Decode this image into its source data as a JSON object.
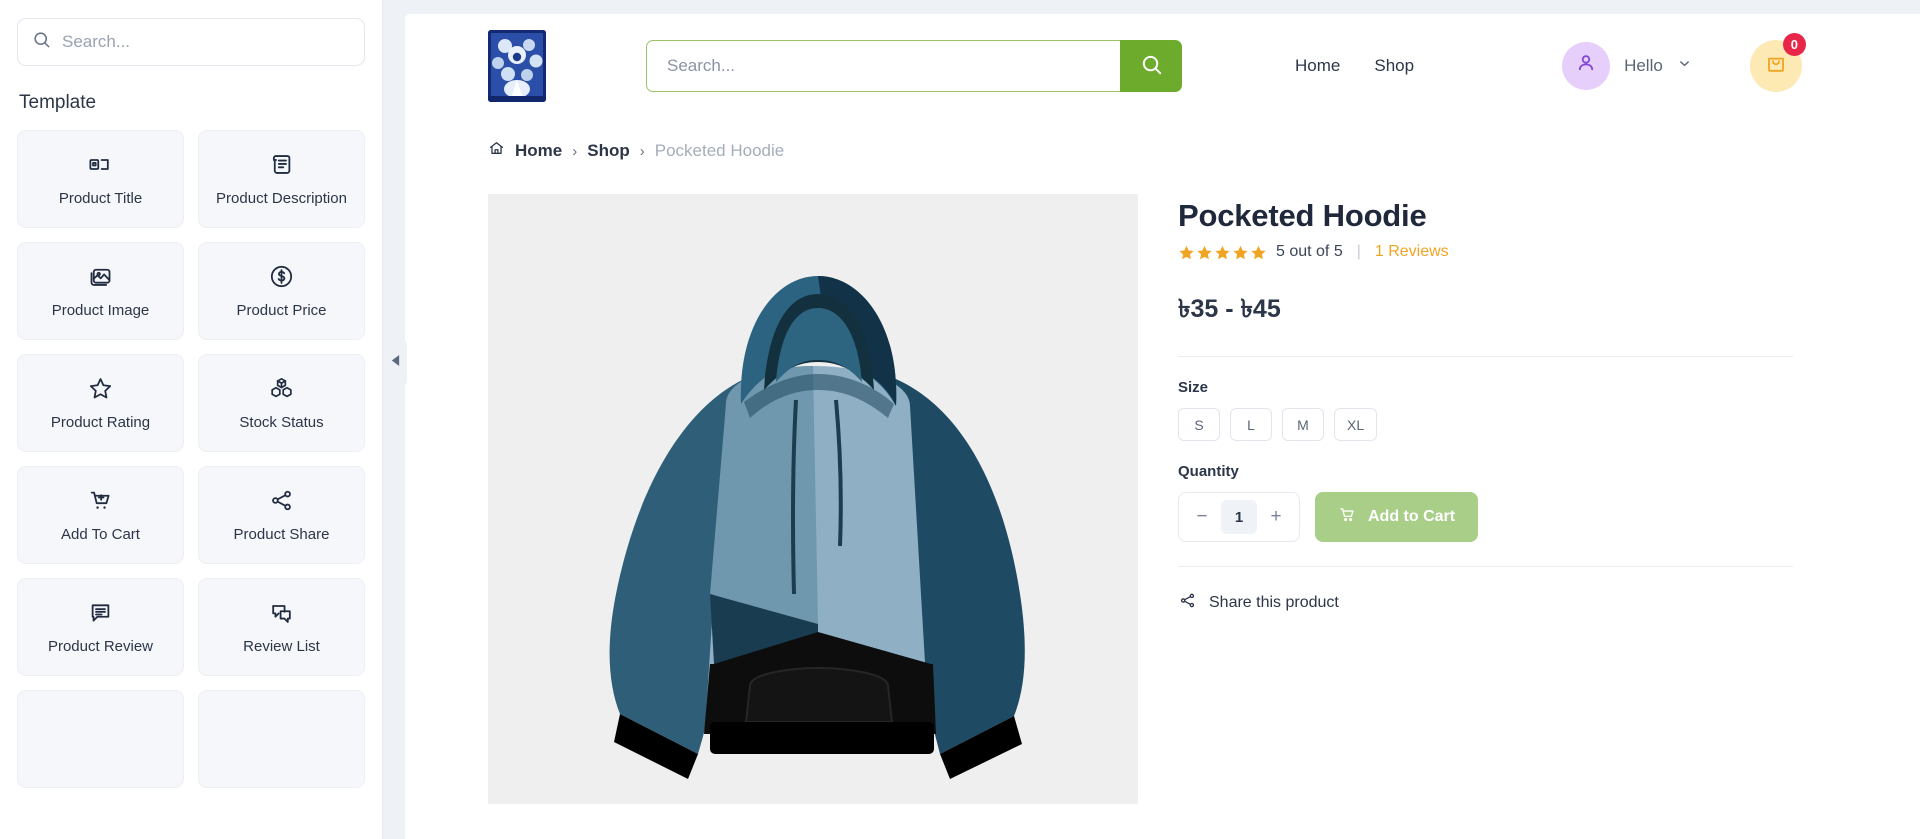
{
  "sidebar": {
    "search_placeholder": "Search...",
    "section_title": "Template",
    "collapse_icon": "chevron-down-icon",
    "panel_handle_icon": "chevron-left-icon",
    "widgets": [
      {
        "label": "Product Title",
        "icon": "product-title-icon"
      },
      {
        "label": "Product Description",
        "icon": "scroll-document-icon"
      },
      {
        "label": "Product Image",
        "icon": "image-stack-icon"
      },
      {
        "label": "Product Price",
        "icon": "dollar-circle-icon"
      },
      {
        "label": "Product Rating",
        "icon": "star-outline-icon"
      },
      {
        "label": "Stock Status",
        "icon": "boxes-stack-icon"
      },
      {
        "label": "Add To Cart",
        "icon": "cart-plus-icon"
      },
      {
        "label": "Product Share",
        "icon": "share-nodes-icon"
      },
      {
        "label": "Product Review",
        "icon": "comment-lines-icon"
      },
      {
        "label": "Review List",
        "icon": "comments-double-icon"
      }
    ]
  },
  "header": {
    "logo_alt": "site-logo",
    "search_placeholder": "Search...",
    "search_value": "",
    "search_button_icon": "search-icon",
    "nav": [
      {
        "label": "Home"
      },
      {
        "label": "Shop"
      }
    ],
    "user": {
      "avatar_icon": "user-icon",
      "greeting": "Hello",
      "chevron_icon": "chevron-down-icon"
    },
    "cart": {
      "icon": "shopping-bag-icon",
      "count": "0"
    }
  },
  "breadcrumb": {
    "home_icon": "home-icon",
    "items": [
      {
        "label": "Home",
        "current": false
      },
      {
        "label": "Shop",
        "current": false
      },
      {
        "label": "Pocketed Hoodie",
        "current": true
      }
    ],
    "separator": "›"
  },
  "product": {
    "image_alt": "pocketed-hoodie-product-image",
    "title": "Pocketed Hoodie",
    "rating_value": 5,
    "rating_text": "5 out of 5",
    "rating_divider": "|",
    "reviews_label": "1 Reviews",
    "price": "৳35 - ৳45",
    "size_label": "Size",
    "sizes": [
      {
        "label": "S"
      },
      {
        "label": "L"
      },
      {
        "label": "M"
      },
      {
        "label": "XL"
      }
    ],
    "quantity_label": "Quantity",
    "quantity_value": "1",
    "decrement_label": "−",
    "increment_label": "+",
    "add_to_cart_label": "Add to Cart",
    "add_to_cart_icon": "cart-icon",
    "share_label": "Share this product",
    "share_icon": "share-nodes-icon"
  },
  "colors": {
    "accent_green": "#6cab2b",
    "add_to_cart_green": "#a8ce87",
    "star_gold": "#f0a422",
    "reviews_gold": "#f0a422",
    "cart_badge_red": "#e8264a",
    "avatar_purple": "#e6cffb",
    "cart_yellow": "#fde9b4",
    "canvas_bg": "#eef1f6",
    "widget_bg": "#f5f7fa",
    "text_dark": "#2c3648"
  }
}
